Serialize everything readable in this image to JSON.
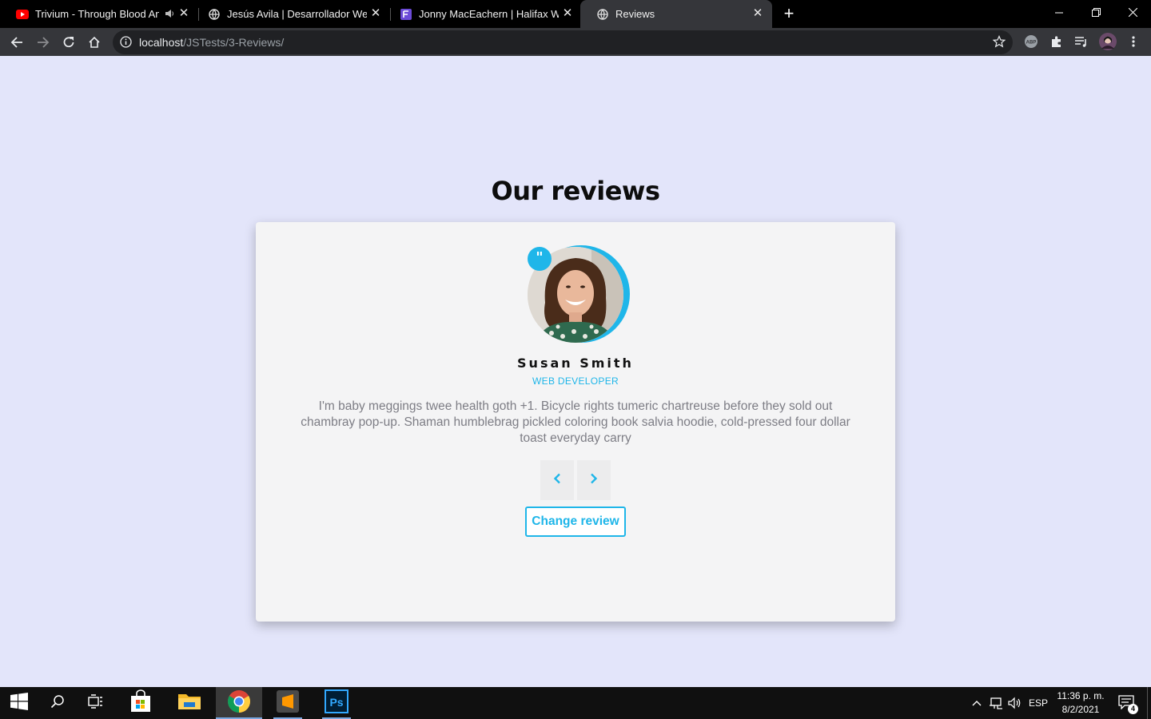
{
  "browser": {
    "tabs": [
      {
        "title": "Trivium - Through Blood And Dirt And Bone",
        "icon": "youtube-icon"
      },
      {
        "title": "Jesús Avila | Desarrollador Web",
        "icon": "globe-icon"
      },
      {
        "title": "Jonny MacEachern | Halifax WordPress",
        "icon": "site-icon"
      },
      {
        "title": "Reviews",
        "icon": "globe-icon"
      }
    ],
    "url_host": "localhost",
    "url_path": "/JSTests/3-Reviews/"
  },
  "page": {
    "heading": "Our reviews",
    "review": {
      "quote_mark": "\"",
      "name": "Susan Smith",
      "job": "WEB DEVELOPER",
      "text": "I'm baby meggings twee health goth +1. Bicycle rights tumeric chartreuse before they sold out chambray pop-up. Shaman humblebrag pickled coloring book salvia hoodie, cold-pressed four dollar toast everyday carry"
    },
    "prev_icon": "chevron-left-icon",
    "next_icon": "chevron-right-icon",
    "change_button": "Change review",
    "accent_color": "#1fb6e9"
  },
  "taskbar": {
    "language": "ESP",
    "time": "11:36 p. m.",
    "date": "8/2/2021",
    "notifications": "4"
  }
}
